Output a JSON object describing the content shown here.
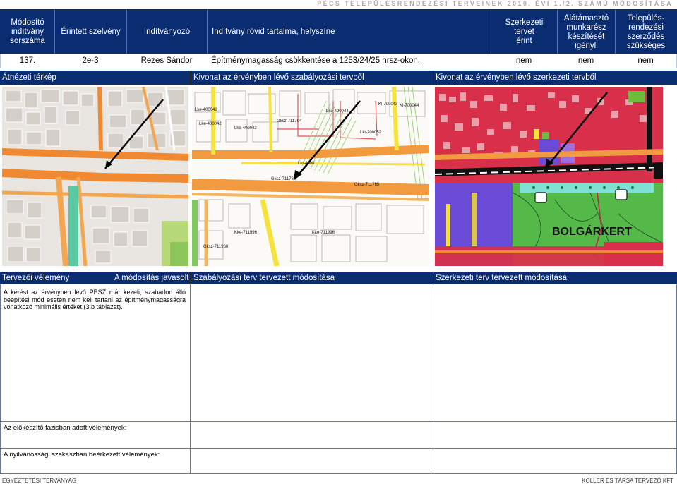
{
  "document_title": "PÉCS TELEPÜLÉSRENDEZÉSI TERVEINEK 2010. ÉVI 1./2. SZÁMÚ MÓDOSÍTÁSA",
  "header": {
    "col_modosito": "Módosító indítvány sorszáma",
    "col_erintett": "Érintett szelvény",
    "col_inditvanyozo": "Indítványozó",
    "col_tartalom": "Indítvány rövid tartalma, helyszíne",
    "col_szerkezeti": "Szerkezeti tervet érint",
    "col_alatamaszto": "Alátámasztó munkarész készítését igényli",
    "col_telepules": "Település-rendezési szerződés szükséges"
  },
  "row": {
    "number": "137.",
    "szelveny": "2e-3",
    "inditvanyozo": "Rezes Sándor",
    "tartalom": "Építménymagasság csökkentése a 1253/24/25 hrsz-okon.",
    "szerkezeti": "nem",
    "alatamaszto": "nem",
    "telepules": "nem"
  },
  "map_headers": {
    "atnezeti": "Átnézeti térkép",
    "szabalyozasi": "Kivonat az érvényben lévő szabályozási tervből",
    "szerkezeti": "Kivonat az érvényben lévő szerkezeti tervből"
  },
  "map_labels": {
    "bolgarkert": "BOLGÁRKERT",
    "zone_labels": [
      "Lke-400042",
      "Lke-400042",
      "Lke-400042",
      "Gksz-711704",
      "Ki-700043",
      "Ki-700044",
      "Lke-400044",
      "Lkt-200052",
      "Gksz-711765",
      "Gksz-711765",
      "Lkt-4008",
      "Kke-711996",
      "Kke-711996",
      "Gksz-711960"
    ]
  },
  "bottom_headers": {
    "tervezoi": "Tervezői vélemény",
    "javasolt": "A módosítás javasolt",
    "szabalyozasi": "Szabályozási terv tervezett módosítása",
    "szerkezeti": "Szerkezeti terv tervezett módosítása"
  },
  "opinion": "A kérést az érvényben lévő PÉSZ már kezeli, szabadon álló beépítési mód esetén nem kell tartani az építménymagasságra vonatkozó minimális értéket.(3.b táblázat).",
  "notes": {
    "elokeszito": "Az előkészítő fázisban adott vélemények:",
    "nyilvanossagi": "A nyilvánossági szakaszban beérkezett vélemények:"
  },
  "footer": {
    "left": "EGYEZTETÉSI TERVANYAG",
    "right": "KOLLER ÉS TÁRSA TERVEZŐ KFT"
  },
  "colors": {
    "header_blue": "#0a2d72",
    "road_orange": "#f29a40",
    "road_yellow": "#f6e23a",
    "green_zone": "#6dbd3c",
    "purple_zone": "#6a4bd6",
    "red_zone": "#d8304a"
  }
}
